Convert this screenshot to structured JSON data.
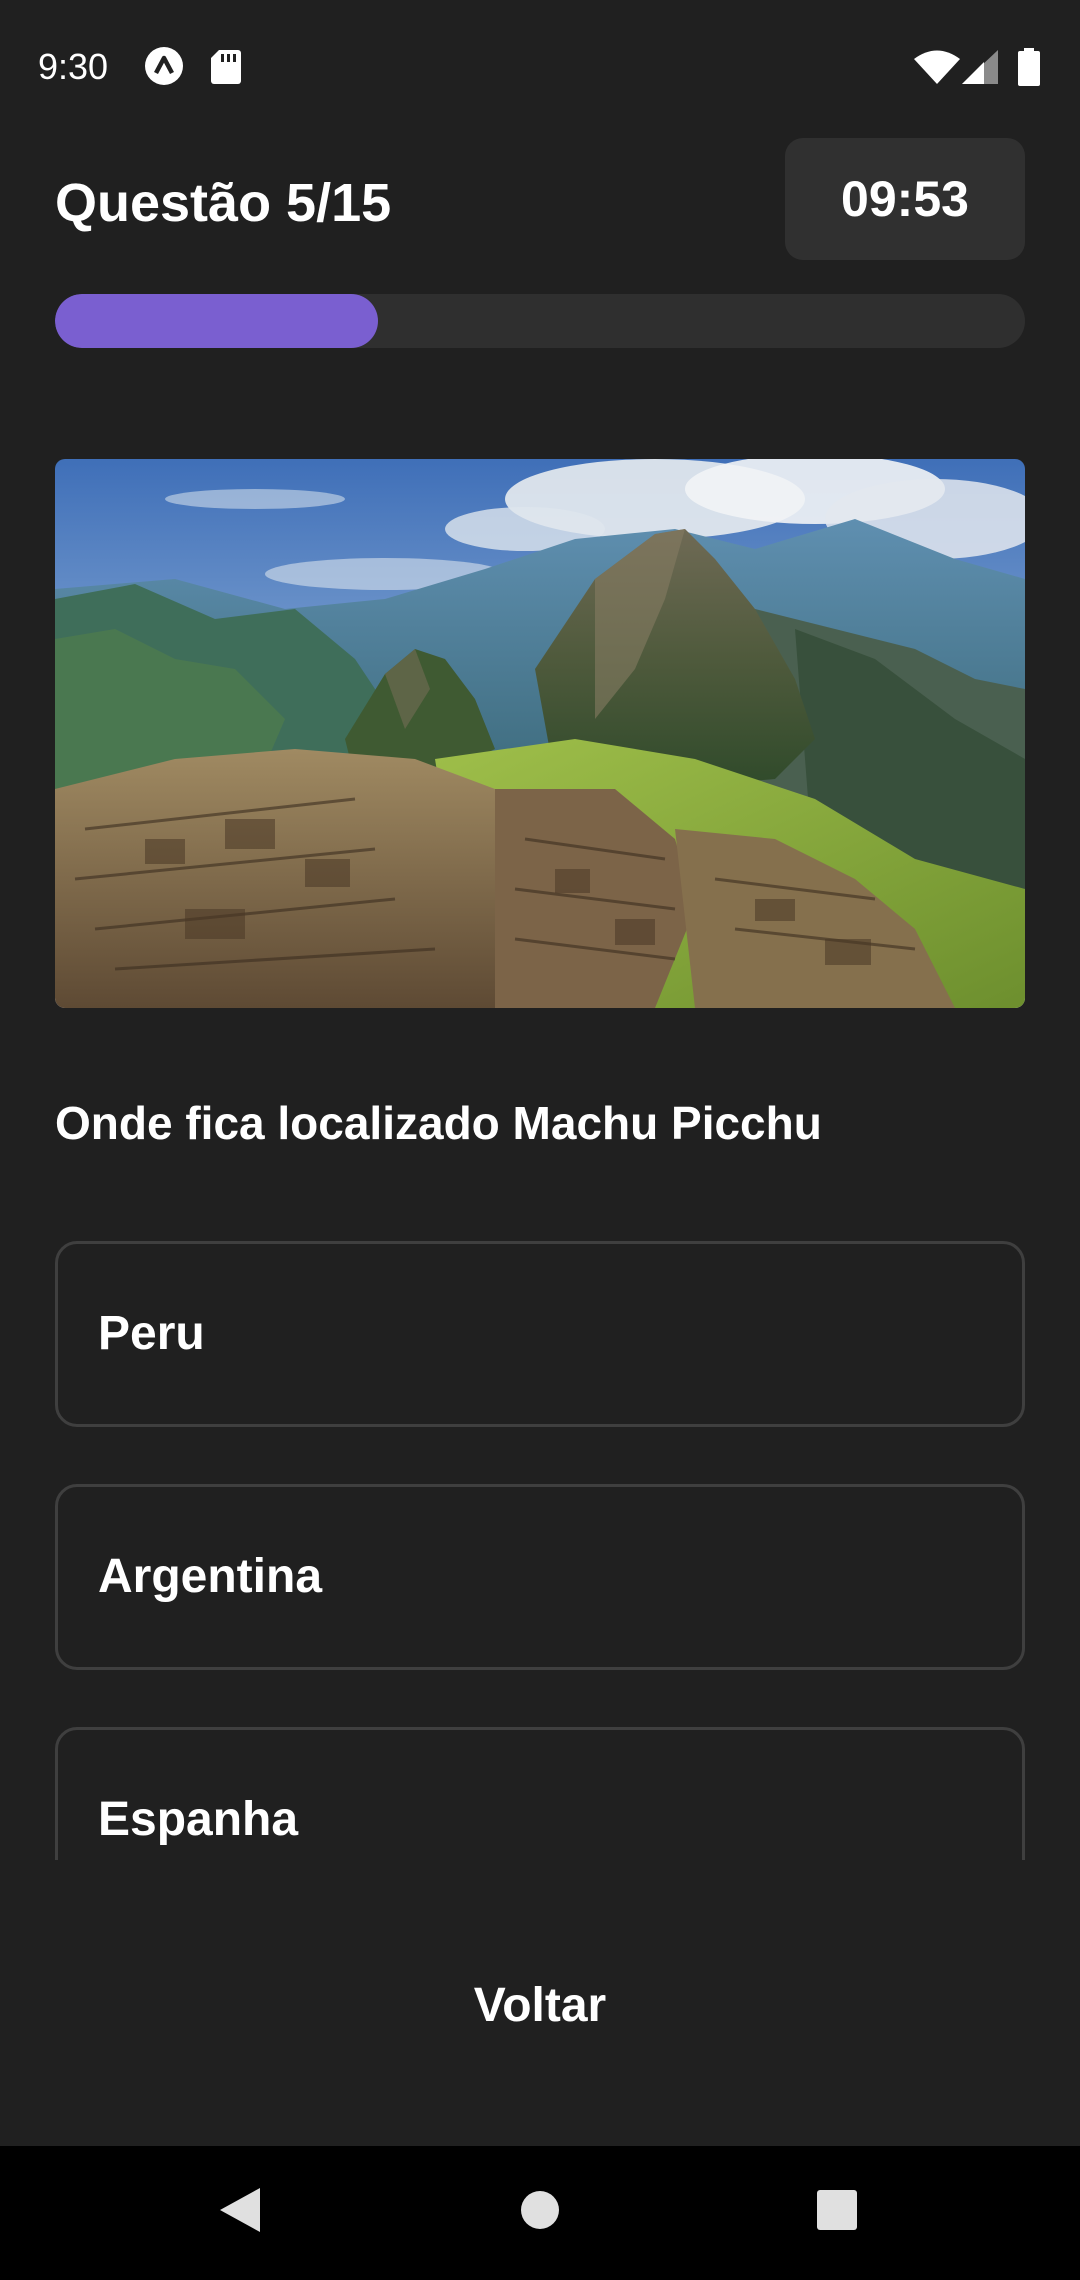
{
  "status_bar": {
    "time": "9:30",
    "icons": [
      "app-a-icon",
      "sd-card-icon",
      "wifi-icon",
      "signal-icon",
      "battery-icon"
    ]
  },
  "quiz": {
    "counter": "Questão 5/15",
    "timer": "09:53",
    "progress": 0.333,
    "image_subject": "Machu Picchu landscape",
    "question": "Onde fica localizado Machu Picchu",
    "options": [
      {
        "label": "Peru"
      },
      {
        "label": "Argentina"
      },
      {
        "label": "Espanha"
      }
    ],
    "back_label": "Voltar"
  },
  "colors": {
    "background": "#202020",
    "accent": "#7a5fd0",
    "track": "#2f2f2f",
    "card_border": "#3f3f3f"
  },
  "nav_bar": {
    "icons": [
      "back-triangle-icon",
      "home-circle-icon",
      "recents-square-icon"
    ]
  }
}
